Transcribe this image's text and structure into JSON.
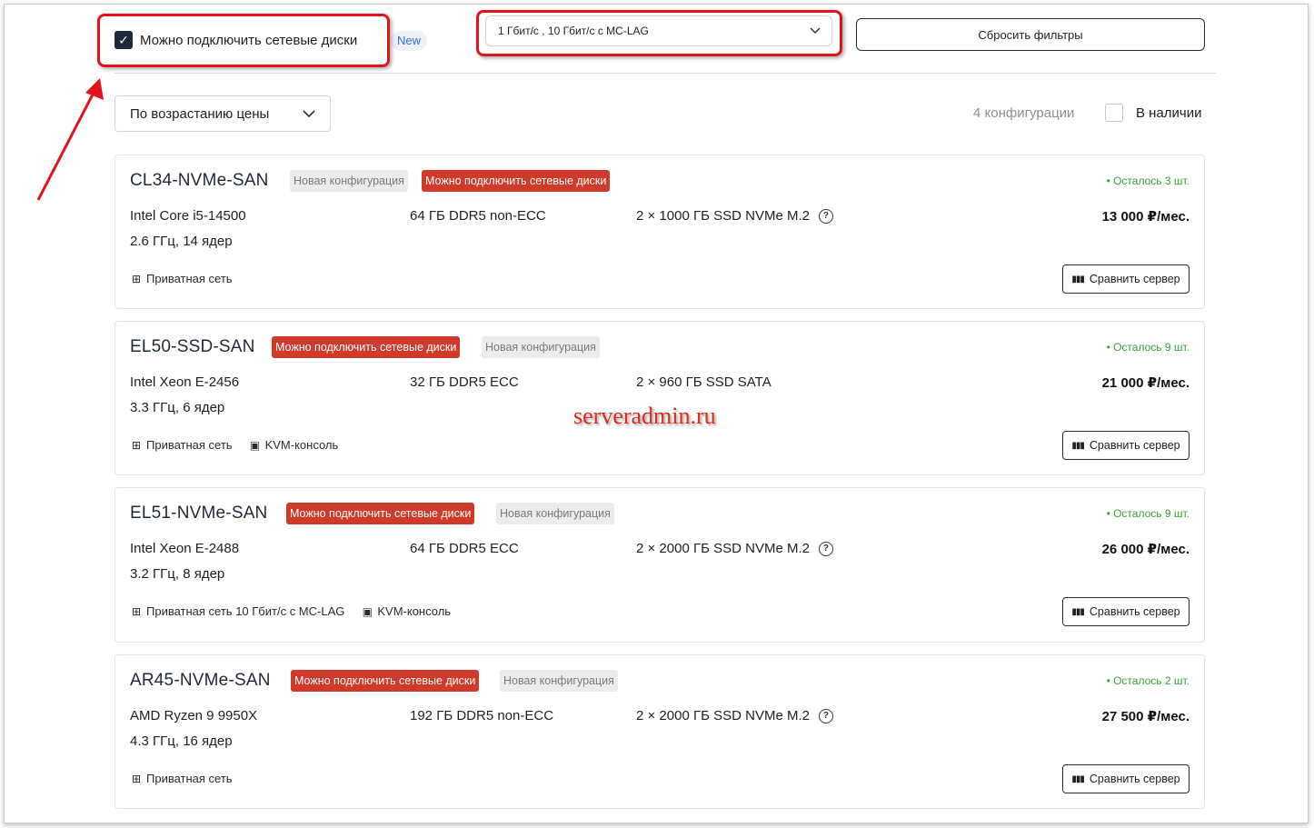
{
  "filters": {
    "network_disks_checkbox": {
      "checked": true,
      "label": "Можно подключить сетевые диски"
    },
    "new_badge": "New",
    "speed_select": "1 Гбит/с , 10 Гбит/с с MC-LAG",
    "reset_label": "Сбросить фильтры"
  },
  "toolbar": {
    "sort_label": "По возрастанию цены",
    "config_count": "4 конфигурации",
    "in_stock_label": "В наличии"
  },
  "watermark": "serveradmin.ru",
  "colors": {
    "highlight": "#e0151b",
    "badge_red": "#cf3a2a",
    "stock_green": "#3aa03a"
  },
  "servers": [
    {
      "name": "CL34-NVMe-SAN",
      "badges": [
        "Новая конфигурация",
        "Можно подключить сетевые диски"
      ],
      "stock": "• Осталось 3 шт.",
      "cpu": "Intel Core i5-14500",
      "freq": "2.6 ГГц, 14 ядер",
      "ram": "64 ГБ DDR5 non-ECC",
      "disk": "2 × 1000 ГБ SSD NVMe M.2",
      "price": "13 000 ₽/мес.",
      "features": [
        "Приватная сеть"
      ],
      "compare": "Сравнить сервер"
    },
    {
      "name": "EL50-SSD-SAN",
      "badges": [
        "Можно подключить сетевые диски",
        "Новая конфигурация"
      ],
      "stock": "• Осталось 9 шт.",
      "cpu": "Intel Xeon E-2456",
      "freq": "3.3 ГГц, 6 ядер",
      "ram": "32 ГБ DDR5 ECC",
      "disk": "2 × 960 ГБ SSD SATA",
      "price": "21 000 ₽/мес.",
      "features": [
        "Приватная сеть",
        "KVM-консоль"
      ],
      "compare": "Сравнить сервер"
    },
    {
      "name": "EL51-NVMe-SAN",
      "badges": [
        "Можно подключить сетевые диски",
        "Новая конфигурация"
      ],
      "stock": "• Осталось 9 шт.",
      "cpu": "Intel Xeon E-2488",
      "freq": "3.2 ГГц, 8 ядер",
      "ram": "64 ГБ DDR5 ECC",
      "disk": "2 × 2000 ГБ SSD NVMe M.2",
      "price": "26 000 ₽/мес.",
      "features": [
        "Приватная сеть 10 Гбит/с с MC-LAG",
        "KVM-консоль"
      ],
      "compare": "Сравнить сервер"
    },
    {
      "name": "AR45-NVMe-SAN",
      "badges": [
        "Можно подключить сетевые диски",
        "Новая конфигурация"
      ],
      "stock": "• Осталось 2 шт.",
      "cpu": "AMD Ryzen 9 9950X",
      "freq": "4.3 ГГц, 16 ядер",
      "ram": "192 ГБ DDR5 non-ECC",
      "disk": "2 × 2000 ГБ SSD NVMe M.2",
      "price": "27 500 ₽/мес.",
      "features": [
        "Приватная сеть"
      ],
      "compare": "Сравнить сервер"
    }
  ]
}
